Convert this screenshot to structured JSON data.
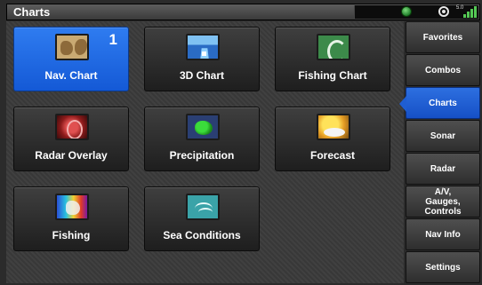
{
  "topbar": {
    "title": "Charts",
    "signal_text": "5.0"
  },
  "tiles": [
    {
      "label": "Nav. Chart",
      "icon": "nav-chart-icon",
      "badge": "1",
      "selected": true
    },
    {
      "label": "3D Chart",
      "icon": "3d-chart-icon"
    },
    {
      "label": "Fishing Chart",
      "icon": "fishing-chart-icon"
    },
    {
      "label": "Radar Overlay",
      "icon": "radar-overlay-icon"
    },
    {
      "label": "Precipitation",
      "icon": "precipitation-icon"
    },
    {
      "label": "Forecast",
      "icon": "forecast-icon"
    },
    {
      "label": "Fishing",
      "icon": "fishing-icon"
    },
    {
      "label": "Sea Conditions",
      "icon": "sea-conditions-icon"
    }
  ],
  "sidebar": {
    "items": [
      {
        "label": "Favorites"
      },
      {
        "label": "Combos"
      },
      {
        "label": "Charts",
        "active": true
      },
      {
        "label": "Sonar"
      },
      {
        "label": "Radar"
      },
      {
        "label": "A/V,\nGauges,\nControls"
      },
      {
        "label": "Nav Info"
      },
      {
        "label": "Settings"
      }
    ]
  },
  "colors": {
    "accent": "#1f5ed2",
    "tile_selected": "#2f7cf0"
  }
}
